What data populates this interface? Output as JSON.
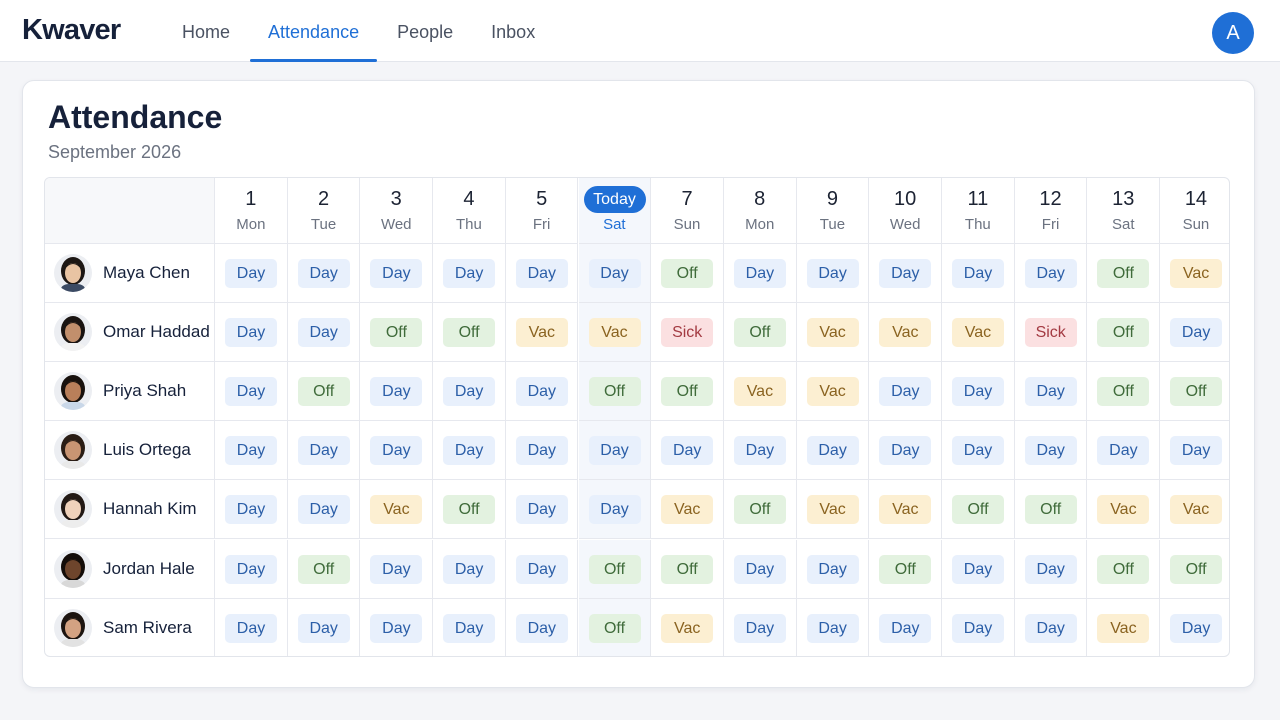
{
  "app": {
    "logo": "Kwaver"
  },
  "nav": {
    "items": [
      "Home",
      "Attendance",
      "People",
      "Inbox"
    ],
    "active": 1
  },
  "user": {
    "initial": "A"
  },
  "page": {
    "title": "Attendance",
    "subtitle": "September 2026"
  },
  "today_label": "Today",
  "days": [
    {
      "num": "1",
      "name": "Mon"
    },
    {
      "num": "2",
      "name": "Tue"
    },
    {
      "num": "3",
      "name": "Wed"
    },
    {
      "num": "4",
      "name": "Thu"
    },
    {
      "num": "5",
      "name": "Fri"
    },
    {
      "num": "6",
      "name": "Sat",
      "today": true
    },
    {
      "num": "7",
      "name": "Sun"
    },
    {
      "num": "8",
      "name": "Mon"
    },
    {
      "num": "9",
      "name": "Tue"
    },
    {
      "num": "10",
      "name": "Wed"
    },
    {
      "num": "11",
      "name": "Thu"
    },
    {
      "num": "12",
      "name": "Fri"
    },
    {
      "num": "13",
      "name": "Sat"
    },
    {
      "num": "14",
      "name": "Sun"
    }
  ],
  "people": [
    {
      "name": "Maya Chen",
      "skin": "#e9c4a3",
      "hair": "#1d1714",
      "shirt": "#3b4a63",
      "status": [
        "Day",
        "Day",
        "Day",
        "Day",
        "Day",
        "Day",
        "Off",
        "Day",
        "Day",
        "Day",
        "Day",
        "Day",
        "Off",
        "Vac"
      ]
    },
    {
      "name": "Omar Haddad",
      "skin": "#c28f6c",
      "hair": "#1a1411",
      "shirt": "#f2f2f2",
      "status": [
        "Day",
        "Day",
        "Off",
        "Off",
        "Vac",
        "Vac",
        "Sick",
        "Off",
        "Vac",
        "Vac",
        "Vac",
        "Sick",
        "Off",
        "Day"
      ]
    },
    {
      "name": "Priya Shah",
      "skin": "#b97f5a",
      "hair": "#18110d",
      "shirt": "#c9d7e8",
      "status": [
        "Day",
        "Off",
        "Day",
        "Day",
        "Day",
        "Off",
        "Off",
        "Vac",
        "Vac",
        "Day",
        "Day",
        "Day",
        "Off",
        "Off"
      ]
    },
    {
      "name": "Luis Ortega",
      "skin": "#c99573",
      "hair": "#2a1d15",
      "shirt": "#e9e9e9",
      "status": [
        "Day",
        "Day",
        "Day",
        "Day",
        "Day",
        "Day",
        "Day",
        "Day",
        "Day",
        "Day",
        "Day",
        "Day",
        "Day",
        "Day"
      ]
    },
    {
      "name": "Hannah Kim",
      "skin": "#f0d2bb",
      "hair": "#221915",
      "shirt": "#ededed",
      "status": [
        "Day",
        "Day",
        "Vac",
        "Off",
        "Day",
        "Day",
        "Vac",
        "Off",
        "Vac",
        "Vac",
        "Off",
        "Off",
        "Vac",
        "Vac"
      ]
    },
    {
      "name": "Jordan Hale",
      "skin": "#6e452c",
      "hair": "#140d09",
      "shirt": "#d8d8d8",
      "status": [
        "Day",
        "Off",
        "Day",
        "Day",
        "Day",
        "Off",
        "Off",
        "Day",
        "Day",
        "Off",
        "Day",
        "Day",
        "Off",
        "Off"
      ]
    },
    {
      "name": "Sam Rivera",
      "skin": "#d3a282",
      "hair": "#1c1410",
      "shirt": "#e2e2e2",
      "status": [
        "Day",
        "Day",
        "Day",
        "Day",
        "Day",
        "Off",
        "Vac",
        "Day",
        "Day",
        "Day",
        "Day",
        "Day",
        "Vac",
        "Day"
      ]
    }
  ]
}
